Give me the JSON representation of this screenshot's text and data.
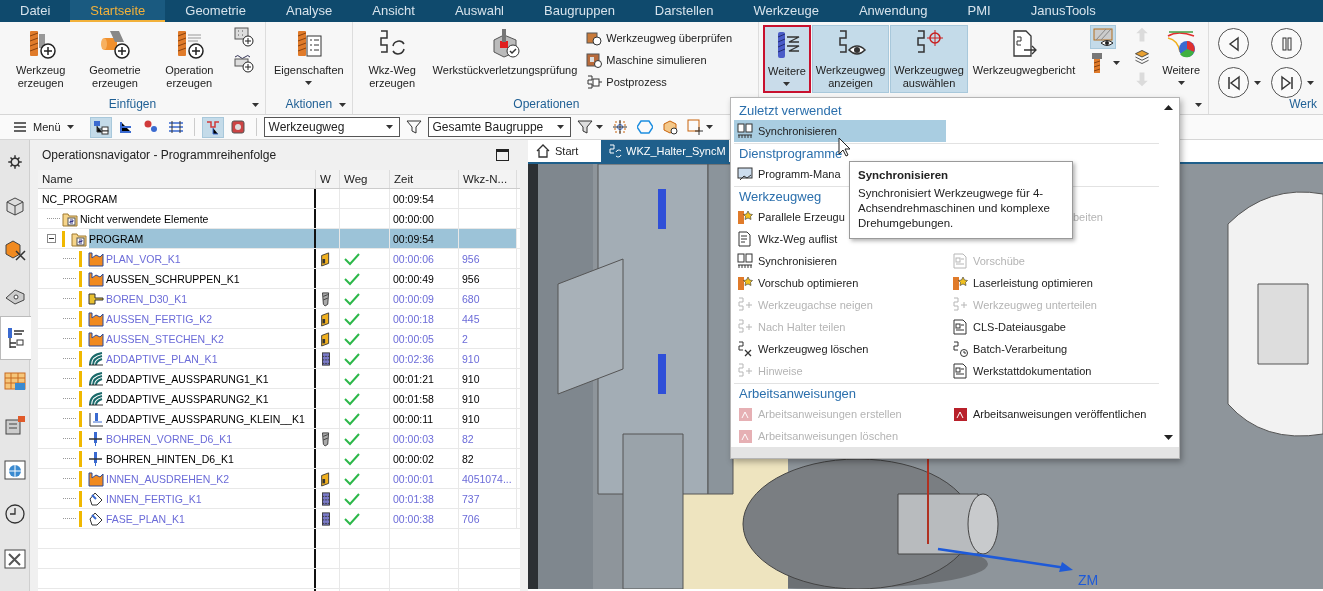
{
  "menu_bar": {
    "tabs": [
      {
        "label": "Datei",
        "selected": false
      },
      {
        "label": "Startseite",
        "selected": true
      },
      {
        "label": "Geometrie",
        "selected": false
      },
      {
        "label": "Analyse",
        "selected": false
      },
      {
        "label": "Ansicht",
        "selected": false
      },
      {
        "label": "Auswahl",
        "selected": false
      },
      {
        "label": "Baugruppen",
        "selected": false
      },
      {
        "label": "Darstellen",
        "selected": false
      },
      {
        "label": "Werkzeuge",
        "selected": false
      },
      {
        "label": "Anwendung",
        "selected": false
      },
      {
        "label": "PMI",
        "selected": false
      },
      {
        "label": "JanusTools",
        "selected": false
      }
    ]
  },
  "ribbon": {
    "groups": [
      {
        "label": "Einfügen",
        "launcher": true,
        "items": [
          {
            "kind": "large",
            "label": "Werkzeug erzeugen"
          },
          {
            "kind": "large",
            "label": "Geometrie erzeugen"
          },
          {
            "kind": "large",
            "label": "Operation erzeugen"
          },
          {
            "kind": "icon-stack",
            "buttons": [
              {
                "on": false,
                "disabled": false,
                "dropdown": false
              },
              {
                "on": false,
                "disabled": false,
                "dropdown": false
              }
            ]
          }
        ]
      },
      {
        "label": "Aktionen",
        "launcher": true,
        "items": [
          {
            "kind": "large",
            "label": "Eigenschaften",
            "dropdown": true
          }
        ]
      },
      {
        "label": "Operationen",
        "launcher": false,
        "items": [
          {
            "kind": "large",
            "label": "Wkz-Weg erzeugen"
          },
          {
            "kind": "large",
            "label": "Werkstückverletzungsprüfung"
          },
          {
            "kind": "stack",
            "entries": [
              {
                "label": "Werkzeugweg überprüfen"
              },
              {
                "label": "Maschine simulieren"
              },
              {
                "label": "Postprozess"
              }
            ]
          }
        ]
      },
      {
        "launcher": true,
        "items": [
          {
            "kind": "large",
            "label": "Weitere",
            "dropdown": true,
            "open": true
          },
          {
            "kind": "large",
            "label": "Werkzeugweg anzeigen",
            "on": true
          },
          {
            "kind": "large",
            "label": "Werkzeugweg auswählen",
            "on": true
          },
          {
            "kind": "large",
            "label": "Werkzeugwegbericht",
            "on": false
          },
          {
            "kind": "icon-stack",
            "buttons": [
              {
                "on": true,
                "disabled": false,
                "dropdown": false
              },
              {
                "on": false,
                "disabled": false,
                "dropdown": true
              }
            ]
          },
          {
            "kind": "icon-stack",
            "buttons": [
              {
                "on": false,
                "disabled": true,
                "dropdown": false
              },
              {
                "on": false,
                "disabled": false,
                "dropdown": false
              },
              {
                "on": false,
                "disabled": true,
                "dropdown": false
              }
            ]
          },
          {
            "kind": "large",
            "label": "Weitere",
            "dropdown": true,
            "on": false
          }
        ]
      },
      {
        "label": "Werk",
        "launcher": false,
        "items": [
          {
            "kind": "player",
            "buttons": [
              {
                "dropdown": false
              },
              {
                "dropdown": false
              },
              {
                "dropdown": true
              },
              {
                "dropdown": true
              }
            ]
          }
        ]
      }
    ]
  },
  "toolbar": {
    "items": [
      {
        "kind": "menu",
        "label": "Menü"
      },
      {
        "kind": "icon",
        "on": true,
        "dropdown": false
      },
      {
        "kind": "icon",
        "on": false,
        "dropdown": false
      },
      {
        "kind": "icon",
        "on": false,
        "dropdown": false
      },
      {
        "kind": "icon",
        "on": false,
        "dropdown": false
      },
      {
        "kind": "separator"
      },
      {
        "kind": "icon",
        "on": true,
        "dropdown": false
      },
      {
        "kind": "icon",
        "on": false,
        "dropdown": false
      },
      {
        "kind": "separator"
      },
      {
        "kind": "select",
        "value": "Werkzeugweg"
      },
      {
        "kind": "icon",
        "on": false,
        "dropdown": false
      },
      {
        "kind": "select",
        "value": "Gesamte Baugruppe"
      },
      {
        "kind": "icon",
        "on": false,
        "dropdown": true
      },
      {
        "kind": "icon",
        "on": false,
        "dropdown": false
      },
      {
        "kind": "icon",
        "on": false,
        "dropdown": false
      },
      {
        "kind": "icon",
        "on": false,
        "dropdown": false
      },
      {
        "kind": "icon",
        "on": false,
        "dropdown": true
      }
    ]
  },
  "sidebar": {
    "items": [
      {
        "selected": false
      },
      {
        "selected": false
      },
      {
        "selected": false
      },
      {
        "selected": false
      },
      {
        "selected": true
      },
      {
        "selected": false
      },
      {
        "selected": false
      },
      {
        "selected": false
      },
      {
        "selected": false
      },
      {
        "selected": false
      }
    ]
  },
  "navigator": {
    "title": "Operationsnavigator - Programmreihenfolge",
    "columns": [
      "Name",
      "W",
      "Weg",
      "Zeit",
      "Wkz-N..."
    ],
    "tree": [
      {
        "name": "NC_PROGRAM",
        "time": "00:09:54",
        "color": "#000000",
        "flag": false,
        "selected": false,
        "children": [
          {
            "kind": "folder",
            "name": "Nicht verwendete Elemente",
            "time": "00:00:00",
            "color": "#000000",
            "flag": false,
            "selected": false
          },
          {
            "kind": "folder",
            "name": "PROGRAM",
            "time": "00:09:54",
            "color": "#000000",
            "flag": true,
            "selected": true,
            "expanded": true,
            "children": [
              {
                "kind": "turning",
                "name": "PLAN_VOR_K1",
                "tool": {
                  "kind": "insert"
                },
                "path_ok": true,
                "time": "00:00:06",
                "number": "956",
                "color": "#6b6bd8",
                "flag": true,
                "selected": false
              },
              {
                "kind": "turning",
                "name": "AUSSEN_SCHRUPPEN_K1",
                "path_ok": true,
                "time": "00:00:49",
                "number": "956",
                "color": "#000000",
                "flag": true,
                "selected": false
              },
              {
                "kind": "boring",
                "name": "BOREN_D30_K1",
                "tool": {
                  "kind": "drill"
                },
                "path_ok": true,
                "time": "00:00:09",
                "number": "680",
                "color": "#6b6bd8",
                "flag": true,
                "selected": false
              },
              {
                "kind": "turning",
                "name": "AUSSEN_FERTIG_K2",
                "tool": {
                  "kind": "insert"
                },
                "path_ok": true,
                "time": "00:00:18",
                "number": "445",
                "color": "#6b6bd8",
                "flag": true,
                "selected": false
              },
              {
                "kind": "turning",
                "name": "AUSSEN_STECHEN_K2",
                "tool": {
                  "kind": "insert"
                },
                "path_ok": true,
                "time": "00:00:05",
                "number": "2",
                "color": "#6b6bd8",
                "flag": true,
                "selected": false
              },
              {
                "kind": "adaptive",
                "name": "ADDAPTIVE_PLAN_K1",
                "tool": {
                  "kind": "mill"
                },
                "path_ok": true,
                "time": "00:02:36",
                "number": "910",
                "color": "#6b6bd8",
                "flag": true,
                "selected": false
              },
              {
                "kind": "adaptive",
                "name": "ADDAPTIVE_AUSSPARUNG1_K1",
                "path_ok": true,
                "time": "00:01:21",
                "number": "910",
                "color": "#000000",
                "flag": true,
                "selected": false
              },
              {
                "kind": "adaptive",
                "name": "ADDAPTIVE_AUSSPARUNG2_K1",
                "path_ok": true,
                "time": "00:01:58",
                "number": "910",
                "color": "#000000",
                "flag": true,
                "selected": false
              },
              {
                "kind": "planar",
                "name": "ADDAPTIVE_AUSSPARUNG_KLEIN__K1",
                "path_ok": true,
                "time": "00:00:11",
                "number": "910",
                "color": "#000000",
                "flag": true,
                "selected": false
              },
              {
                "kind": "drilling",
                "name": "BOHREN_VORNE_D6_K1",
                "tool": {
                  "kind": "drill"
                },
                "path_ok": true,
                "time": "00:00:03",
                "number": "82",
                "color": "#6b6bd8",
                "flag": true,
                "selected": false
              },
              {
                "kind": "drilling",
                "name": "BOHREN_HINTEN_D6_K1",
                "path_ok": true,
                "time": "00:00:02",
                "number": "82",
                "color": "#000000",
                "flag": true,
                "selected": false
              },
              {
                "kind": "turning",
                "name": "INNEN_AUSDREHEN_K2",
                "tool": {
                  "kind": "insert"
                },
                "path_ok": true,
                "time": "00:00:01",
                "number": "4051074...",
                "color": "#6b6bd8",
                "flag": true,
                "selected": false
              },
              {
                "kind": "chamfer",
                "name": "INNEN_FERTIG_K1",
                "tool": {
                  "kind": "mill"
                },
                "path_ok": true,
                "time": "00:01:38",
                "number": "737",
                "color": "#6b6bd8",
                "flag": true,
                "selected": false
              },
              {
                "kind": "chamfer",
                "name": "FASE_PLAN_K1",
                "tool": {
                  "kind": "mill"
                },
                "path_ok": true,
                "time": "00:00:38",
                "number": "706",
                "color": "#6b6bd8",
                "flag": true,
                "selected": false
              }
            ]
          }
        ]
      }
    ]
  },
  "viewport": {
    "tabs": [
      {
        "label": "Start",
        "selected": false
      },
      {
        "label": "WKZ_Halter_SyncM",
        "selected": true
      }
    ],
    "axis_label": "ZM"
  },
  "dropdown_menu": {
    "sections": [
      {
        "title": "Zuletzt verwendet",
        "rows": [
          [
            {
              "kind": "item",
              "label": "Synchronisieren",
              "selected": true,
              "disabled": false
            }
          ]
        ]
      },
      {
        "title": "Dienstprogramme",
        "rows": [
          [
            {
              "kind": "item",
              "label": "Programm-Mana",
              "selected": false,
              "disabled": false
            }
          ]
        ]
      },
      {
        "title": "Werkzeugweg",
        "rows": [
          [
            {
              "kind": "item",
              "label": "Parallele Erzeugu",
              "selected": false,
              "disabled": false
            },
            {
              "kind": "fragment",
              "label": "beiten",
              "selected": false,
              "disabled": true
            }
          ],
          [
            {
              "kind": "item",
              "label": "Wkz-Weg auflist",
              "selected": false,
              "disabled": false
            }
          ],
          [
            {
              "kind": "item",
              "label": "Synchronisieren",
              "selected": false,
              "disabled": false
            },
            {
              "kind": "item",
              "label": "Vorschübe",
              "selected": false,
              "disabled": true
            }
          ],
          [
            {
              "kind": "item",
              "label": "Vorschub optimieren",
              "selected": false,
              "disabled": false
            },
            {
              "kind": "item",
              "label": "Laserleistung optimieren",
              "selected": false,
              "disabled": false
            }
          ],
          [
            {
              "kind": "item",
              "label": "Werkzeugachse neigen",
              "selected": false,
              "disabled": true
            },
            {
              "kind": "item",
              "label": "Werkzeugweg unterteilen",
              "selected": false,
              "disabled": true
            }
          ],
          [
            {
              "kind": "item",
              "label": "Nach Halter teilen",
              "selected": false,
              "disabled": true
            },
            {
              "kind": "item",
              "label": "CLS-Dateiausgabe",
              "selected": false,
              "disabled": false
            }
          ],
          [
            {
              "kind": "item",
              "label": "Werkzeugweg löschen",
              "selected": false,
              "disabled": false
            },
            {
              "kind": "item",
              "label": "Batch-Verarbeitung",
              "selected": false,
              "disabled": false
            }
          ],
          [
            {
              "kind": "item",
              "label": "Hinweise",
              "selected": false,
              "disabled": true
            },
            {
              "kind": "item",
              "label": "Werkstattdokumentation",
              "selected": false,
              "disabled": false
            }
          ]
        ]
      },
      {
        "title": "Arbeitsanweisungen",
        "rows": [
          [
            {
              "kind": "item",
              "label": "Arbeitsanweisungen erstellen",
              "selected": false,
              "disabled": true
            },
            {
              "kind": "item",
              "label": "Arbeitsanweisungen veröffentlichen",
              "selected": false,
              "disabled": false
            }
          ],
          [
            {
              "kind": "item",
              "label": "Arbeitsanweisungen löschen",
              "selected": false,
              "disabled": true
            }
          ]
        ]
      }
    ]
  },
  "tooltip": {
    "title": "Synchronisieren",
    "text": "Synchronisiert Werkzeugwege für 4-Achsendrehmaschinen und komplexe Drehumgebungen."
  }
}
